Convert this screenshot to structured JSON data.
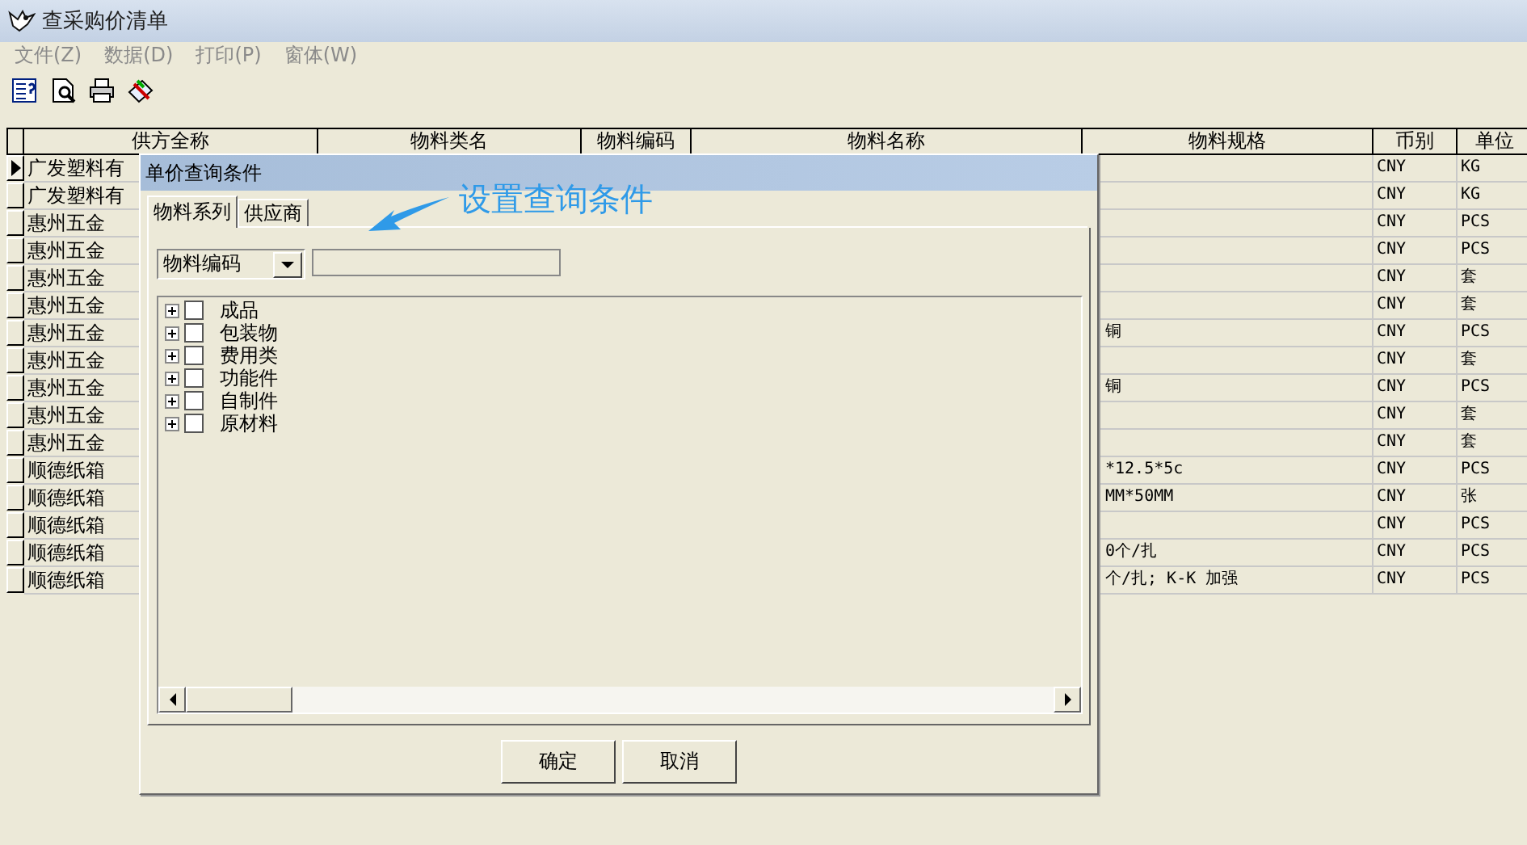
{
  "window": {
    "title": "查采购价清单"
  },
  "menu": [
    {
      "label": "文件(Z)",
      "disabled": true
    },
    {
      "label": "数据(D)",
      "disabled": true
    },
    {
      "label": "打印(P)",
      "disabled": true
    },
    {
      "label": "窗体(W)",
      "disabled": true
    }
  ],
  "toolbar": [
    {
      "kind": "list"
    },
    {
      "kind": "preview"
    },
    {
      "kind": "print"
    },
    {
      "kind": "edit"
    }
  ],
  "table": {
    "columns": [
      "供方全称",
      "物料类名",
      "物料编码",
      "物料名称",
      "物料规格",
      "币别",
      "单位"
    ],
    "rows": [
      {
        "current": true,
        "supplier": "广发塑料有",
        "spec": "",
        "currency": "CNY",
        "unit": "KG"
      },
      {
        "current": false,
        "supplier": "广发塑料有",
        "spec": "",
        "currency": "CNY",
        "unit": "KG"
      },
      {
        "current": false,
        "supplier": "惠州五金",
        "spec": "",
        "currency": "CNY",
        "unit": "PCS"
      },
      {
        "current": false,
        "supplier": "惠州五金",
        "spec": "",
        "currency": "CNY",
        "unit": "PCS"
      },
      {
        "current": false,
        "supplier": "惠州五金",
        "spec": "",
        "currency": "CNY",
        "unit": "套"
      },
      {
        "current": false,
        "supplier": "惠州五金",
        "spec": "",
        "currency": "CNY",
        "unit": "套"
      },
      {
        "current": false,
        "supplier": "惠州五金",
        "spec": "铜",
        "currency": "CNY",
        "unit": "PCS"
      },
      {
        "current": false,
        "supplier": "惠州五金",
        "spec": "",
        "currency": "CNY",
        "unit": "套"
      },
      {
        "current": false,
        "supplier": "惠州五金",
        "spec": "铜",
        "currency": "CNY",
        "unit": "PCS"
      },
      {
        "current": false,
        "supplier": "惠州五金",
        "spec": "",
        "currency": "CNY",
        "unit": "套"
      },
      {
        "current": false,
        "supplier": "惠州五金",
        "spec": "",
        "currency": "CNY",
        "unit": "套"
      },
      {
        "current": false,
        "supplier": "顺德纸箱",
        "spec": "*12.5*5c",
        "currency": "CNY",
        "unit": "PCS"
      },
      {
        "current": false,
        "supplier": "顺德纸箱",
        "spec": "MM*50MM",
        "currency": "CNY",
        "unit": "张"
      },
      {
        "current": false,
        "supplier": "顺德纸箱",
        "spec": "",
        "currency": "CNY",
        "unit": "PCS"
      },
      {
        "current": false,
        "supplier": "顺德纸箱",
        "spec": "0个/扎",
        "currency": "CNY",
        "unit": "PCS"
      },
      {
        "current": false,
        "supplier": "顺德纸箱",
        "spec": "个/扎; K-K 加强",
        "currency": "CNY",
        "unit": "PCS"
      }
    ]
  },
  "dialog": {
    "title": "单价查询条件",
    "tabs": [
      {
        "label": "物料系列",
        "selected": true
      },
      {
        "label": "供应商",
        "selected": false
      }
    ],
    "field_select": {
      "value": "物料编码"
    },
    "tree": [
      {
        "label": "成品",
        "checked": false,
        "expanded": false
      },
      {
        "label": "包装物",
        "checked": false,
        "expanded": false
      },
      {
        "label": "费用类",
        "checked": false,
        "expanded": false
      },
      {
        "label": "功能件",
        "checked": false,
        "expanded": false
      },
      {
        "label": "自制件",
        "checked": false,
        "expanded": false
      },
      {
        "label": "原材料",
        "checked": false,
        "expanded": false
      }
    ],
    "buttons": [
      "确定",
      "取消"
    ]
  },
  "annotation": {
    "text": "设置查询条件"
  }
}
